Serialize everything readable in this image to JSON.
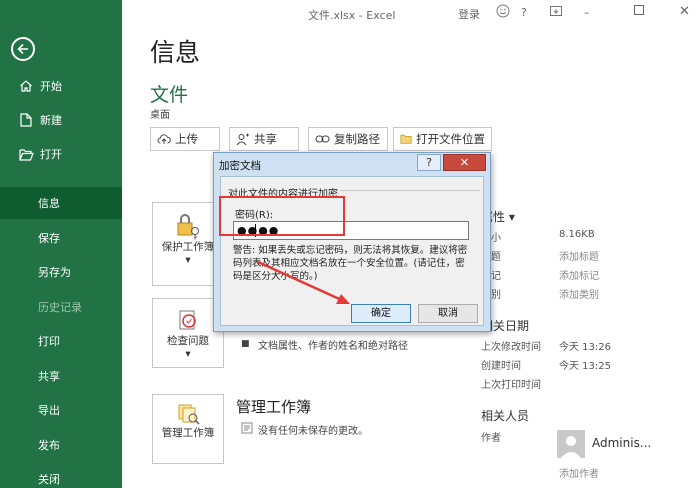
{
  "window": {
    "title": "文件.xlsx  -  Excel",
    "login": "登录",
    "face_icon": "smiley-icon"
  },
  "sidebar": {
    "items": [
      {
        "id": "home",
        "label": "开始",
        "icon": "home-icon"
      },
      {
        "id": "new",
        "label": "新建",
        "icon": "new-doc-icon"
      },
      {
        "id": "open",
        "label": "打开",
        "icon": "folder-open-icon"
      },
      {
        "id": "info",
        "label": "信息",
        "active": true
      },
      {
        "id": "save",
        "label": "保存"
      },
      {
        "id": "saveas",
        "label": "另存为"
      },
      {
        "id": "history",
        "label": "历史记录",
        "disabled": true
      },
      {
        "id": "print",
        "label": "打印"
      },
      {
        "id": "share",
        "label": "共享"
      },
      {
        "id": "export",
        "label": "导出"
      },
      {
        "id": "publish",
        "label": "发布"
      },
      {
        "id": "close",
        "label": "关闭"
      }
    ]
  },
  "main": {
    "page_title": "信息",
    "file_name": "文件",
    "file_location": "桌面",
    "actions": {
      "upload": "上传",
      "share": "共享",
      "copy_path": "复制路径",
      "open_location": "打开文件位置"
    },
    "tiles": {
      "protect": "保护工作簿",
      "check": "检查问题",
      "manage": "管理工作簿"
    },
    "inspect": {
      "bullet_text": "文档属性、作者的姓名和绝对路径"
    },
    "manage_section": {
      "title": "管理工作簿",
      "text": "没有任何未保存的更改。"
    }
  },
  "properties": {
    "header": "属性",
    "rows": [
      {
        "key": "大小",
        "value": "8.16KB"
      },
      {
        "key": "标题",
        "value": "添加标题"
      },
      {
        "key": "标记",
        "value": "添加标记"
      },
      {
        "key": "类别",
        "value": "添加类别"
      }
    ],
    "dates_header": "相关日期",
    "dates": [
      {
        "key": "上次修改时间",
        "value": "今天 13:26"
      },
      {
        "key": "创建时间",
        "value": "今天 13:25"
      },
      {
        "key": "上次打印时间",
        "value": ""
      }
    ],
    "people_header": "相关人员",
    "author_label": "作者",
    "author_name": "Adminis...",
    "add_author": "添加作者"
  },
  "dialog": {
    "title": "加密文档",
    "help": "?",
    "close": "✕",
    "group_label": "对此文件的内容进行加密",
    "password_label": "密码(R):",
    "password_value": "●●●●",
    "warning": "警告: 如果丢失或忘记密码，则无法将其恢复。建议将密码列表及其相应文档名放在一个安全位置。(请记住，密码是区分大小写的。)",
    "ok": "确定",
    "cancel": "取消"
  }
}
